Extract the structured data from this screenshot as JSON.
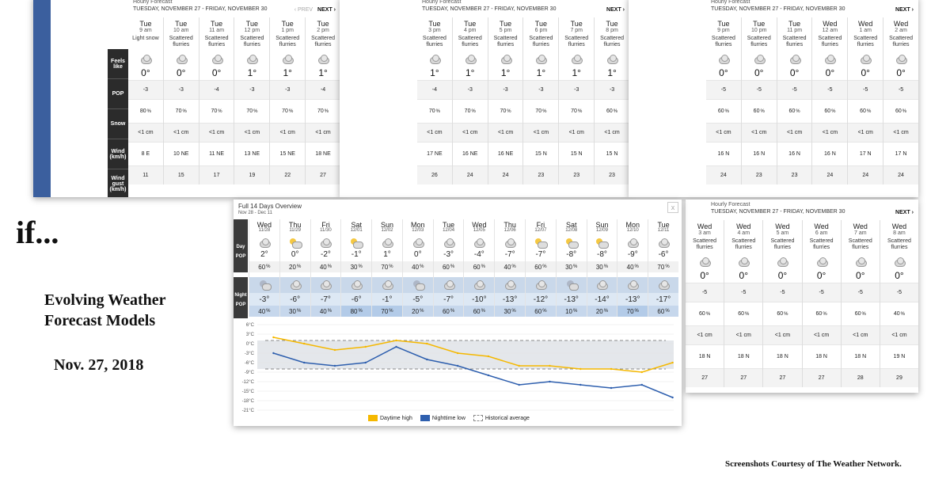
{
  "colors": {
    "daytime": "#f5b800",
    "nighttime": "#2e5fae",
    "historical": "#888888"
  },
  "slide": {
    "if_text": "if...",
    "heading_line1": "Evolving Weather",
    "heading_line2": "Forecast Models",
    "date": "Nov. 27, 2018",
    "credit": "Screenshots Courtesy of The Weather Network."
  },
  "hourly_header": {
    "title": "Hourly Forecast",
    "range": "TUESDAY, NOVEMBER 27 - FRIDAY, NOVEMBER 30",
    "prev": "‹ PREV",
    "next": "NEXT ›"
  },
  "row_labels": {
    "feels": "Feels like",
    "pop": "POP",
    "snow": "Snow",
    "wind": "Wind (km/h)",
    "gust": "Wind gust (km/h)"
  },
  "panel1": [
    {
      "day": "Tue",
      "time": "9 am",
      "cond": "Light snow",
      "temp": "0°",
      "feels": "-3",
      "pop": "80",
      "snow": "<1 cm",
      "wind": "8 E",
      "gust": "11",
      "icon": "cloud-snow-icon"
    },
    {
      "day": "Tue",
      "time": "10 am",
      "cond": "Scattered flurries",
      "temp": "0°",
      "feels": "-3",
      "pop": "70",
      "snow": "<1 cm",
      "wind": "10 NE",
      "gust": "15",
      "icon": "cloud-snow-icon"
    },
    {
      "day": "Tue",
      "time": "11 am",
      "cond": "Scattered flurries",
      "temp": "0°",
      "feels": "-4",
      "pop": "70",
      "snow": "<1 cm",
      "wind": "11 NE",
      "gust": "17",
      "icon": "cloud-snow-icon"
    },
    {
      "day": "Tue",
      "time": "12 pm",
      "cond": "Scattered flurries",
      "temp": "1°",
      "feels": "-3",
      "pop": "70",
      "snow": "<1 cm",
      "wind": "13 NE",
      "gust": "19",
      "icon": "cloud-snow-icon"
    },
    {
      "day": "Tue",
      "time": "1 pm",
      "cond": "Scattered flurries",
      "temp": "1°",
      "feels": "-3",
      "pop": "70",
      "snow": "<1 cm",
      "wind": "15 NE",
      "gust": "22",
      "icon": "cloud-snow-icon"
    },
    {
      "day": "Tue",
      "time": "2 pm",
      "cond": "Scattered flurries",
      "temp": "1°",
      "feels": "-4",
      "pop": "70",
      "snow": "<1 cm",
      "wind": "18 NE",
      "gust": "27",
      "icon": "cloud-snow-icon"
    }
  ],
  "panel2": [
    {
      "day": "Tue",
      "time": "3 pm",
      "cond": "Scattered flurries",
      "temp": "1°",
      "feels": "-4",
      "pop": "70",
      "snow": "<1 cm",
      "wind": "17 NE",
      "gust": "26"
    },
    {
      "day": "Tue",
      "time": "4 pm",
      "cond": "Scattered flurries",
      "temp": "1°",
      "feels": "-3",
      "pop": "70",
      "snow": "<1 cm",
      "wind": "16 NE",
      "gust": "24"
    },
    {
      "day": "Tue",
      "time": "5 pm",
      "cond": "Scattered flurries",
      "temp": "1°",
      "feels": "-3",
      "pop": "70",
      "snow": "<1 cm",
      "wind": "16 NE",
      "gust": "24"
    },
    {
      "day": "Tue",
      "time": "6 pm",
      "cond": "Scattered flurries",
      "temp": "1°",
      "feels": "-3",
      "pop": "70",
      "snow": "<1 cm",
      "wind": "15 N",
      "gust": "23"
    },
    {
      "day": "Tue",
      "time": "7 pm",
      "cond": "Scattered flurries",
      "temp": "1°",
      "feels": "-3",
      "pop": "70",
      "snow": "<1 cm",
      "wind": "15 N",
      "gust": "23"
    },
    {
      "day": "Tue",
      "time": "8 pm",
      "cond": "Scattered flurries",
      "temp": "1°",
      "feels": "-3",
      "pop": "60",
      "snow": "<1 cm",
      "wind": "15 N",
      "gust": "23"
    }
  ],
  "panel3": [
    {
      "day": "Tue",
      "time": "9 pm",
      "cond": "Scattered flurries",
      "temp": "0°",
      "feels": "-5",
      "pop": "60",
      "snow": "<1 cm",
      "wind": "16 N",
      "gust": "24"
    },
    {
      "day": "Tue",
      "time": "10 pm",
      "cond": "Scattered flurries",
      "temp": "0°",
      "feels": "-5",
      "pop": "60",
      "snow": "<1 cm",
      "wind": "16 N",
      "gust": "23"
    },
    {
      "day": "Tue",
      "time": "11 pm",
      "cond": "Scattered flurries",
      "temp": "0°",
      "feels": "-5",
      "pop": "60",
      "snow": "<1 cm",
      "wind": "16 N",
      "gust": "23"
    },
    {
      "day": "Wed",
      "time": "12 am",
      "cond": "Scattered flurries",
      "temp": "0°",
      "feels": "-5",
      "pop": "60",
      "snow": "<1 cm",
      "wind": "16 N",
      "gust": "24"
    },
    {
      "day": "Wed",
      "time": "1 am",
      "cond": "Scattered flurries",
      "temp": "0°",
      "feels": "-5",
      "pop": "60",
      "snow": "<1 cm",
      "wind": "17 N",
      "gust": "24"
    },
    {
      "day": "Wed",
      "time": "2 am",
      "cond": "Scattered flurries",
      "temp": "0°",
      "feels": "-5",
      "pop": "60",
      "snow": "<1 cm",
      "wind": "17 N",
      "gust": "24"
    }
  ],
  "panel4": [
    {
      "day": "Wed",
      "time": "3 am",
      "cond": "Scattered flurries",
      "temp": "0°",
      "feels": "-5",
      "pop": "60",
      "snow": "<1 cm",
      "wind": "18 N",
      "gust": "27"
    },
    {
      "day": "Wed",
      "time": "4 am",
      "cond": "Scattered flurries",
      "temp": "0°",
      "feels": "-5",
      "pop": "60",
      "snow": "<1 cm",
      "wind": "18 N",
      "gust": "27"
    },
    {
      "day": "Wed",
      "time": "5 am",
      "cond": "Scattered flurries",
      "temp": "0°",
      "feels": "-5",
      "pop": "60",
      "snow": "<1 cm",
      "wind": "18 N",
      "gust": "27"
    },
    {
      "day": "Wed",
      "time": "6 am",
      "cond": "Scattered flurries",
      "temp": "0°",
      "feels": "-5",
      "pop": "60",
      "snow": "<1 cm",
      "wind": "18 N",
      "gust": "27"
    },
    {
      "day": "Wed",
      "time": "7 am",
      "cond": "Scattered flurries",
      "temp": "0°",
      "feels": "-5",
      "pop": "60",
      "snow": "<1 cm",
      "wind": "18 N",
      "gust": "28"
    },
    {
      "day": "Wed",
      "time": "8 am",
      "cond": "Scattered flurries",
      "temp": "0°",
      "feels": "-5",
      "pop": "40",
      "snow": "<1 cm",
      "wind": "19 N",
      "gust": "29"
    }
  ],
  "overview": {
    "title": "Full 14 Days Overview",
    "range": "Nov 28 - Dec 11",
    "close": "x",
    "labels": {
      "day": "Day",
      "pop": "POP",
      "night": "Night"
    },
    "pct": "%",
    "days": [
      {
        "d": "Wed",
        "date": "11/28",
        "hi": "2°",
        "dpop": "60",
        "lo": "-3°",
        "npop": "40",
        "di": "cloud",
        "ni": "moon"
      },
      {
        "d": "Thu",
        "date": "11/29",
        "hi": "0°",
        "dpop": "20",
        "lo": "-6°",
        "npop": "30",
        "di": "sun",
        "ni": "cloud"
      },
      {
        "d": "Fri",
        "date": "11/30",
        "hi": "-2°",
        "dpop": "40",
        "lo": "-7°",
        "npop": "40",
        "di": "cloud",
        "ni": "cloud"
      },
      {
        "d": "Sat",
        "date": "12/01",
        "hi": "-1°",
        "dpop": "30",
        "lo": "-6°",
        "npop": "80",
        "di": "sun",
        "ni": "cloud"
      },
      {
        "d": "Sun",
        "date": "12/02",
        "hi": "1°",
        "dpop": "70",
        "lo": "-1°",
        "npop": "70",
        "di": "cloud",
        "ni": "cloud"
      },
      {
        "d": "Mon",
        "date": "12/03",
        "hi": "0°",
        "dpop": "40",
        "lo": "-5°",
        "npop": "20",
        "di": "cloud",
        "ni": "moon"
      },
      {
        "d": "Tue",
        "date": "12/04",
        "hi": "-3°",
        "dpop": "60",
        "lo": "-7°",
        "npop": "60",
        "di": "cloud",
        "ni": "cloud"
      },
      {
        "d": "Wed",
        "date": "12/05",
        "hi": "-4°",
        "dpop": "60",
        "lo": "-10°",
        "npop": "60",
        "di": "cloud",
        "ni": "cloud"
      },
      {
        "d": "Thu",
        "date": "12/06",
        "hi": "-7°",
        "dpop": "40",
        "lo": "-13°",
        "npop": "30",
        "di": "cloud",
        "ni": "cloud"
      },
      {
        "d": "Fri",
        "date": "12/07",
        "hi": "-7°",
        "dpop": "60",
        "lo": "-12°",
        "npop": "60",
        "di": "sun",
        "ni": "cloud"
      },
      {
        "d": "Sat",
        "date": "12/08",
        "hi": "-8°",
        "dpop": "30",
        "lo": "-13°",
        "npop": "10",
        "di": "sun",
        "ni": "moon"
      },
      {
        "d": "Sun",
        "date": "12/09",
        "hi": "-8°",
        "dpop": "30",
        "lo": "-14°",
        "npop": "20",
        "di": "sun",
        "ni": "cloud"
      },
      {
        "d": "Mon",
        "date": "12/10",
        "hi": "-9°",
        "dpop": "40",
        "lo": "-13°",
        "npop": "70",
        "di": "cloud",
        "ni": "cloud"
      },
      {
        "d": "Tue",
        "date": "12/11",
        "hi": "-6°",
        "dpop": "70",
        "lo": "-17°",
        "npop": "60",
        "di": "cloud",
        "ni": "cloud"
      }
    ],
    "legend": {
      "day": "Daytime high",
      "night": "Nighttime low",
      "hist": "Historical average"
    }
  },
  "chart_data": {
    "type": "line",
    "x": [
      "11/28",
      "11/29",
      "11/30",
      "12/01",
      "12/02",
      "12/03",
      "12/04",
      "12/05",
      "12/06",
      "12/07",
      "12/08",
      "12/09",
      "12/10",
      "12/11"
    ],
    "series": [
      {
        "name": "Daytime high",
        "values": [
          2,
          0,
          -2,
          -1,
          1,
          0,
          -3,
          -4,
          -7,
          -7,
          -8,
          -8,
          -9,
          -6
        ]
      },
      {
        "name": "Nighttime low",
        "values": [
          -3,
          -6,
          -7,
          -6,
          -1,
          -5,
          -7,
          -10,
          -13,
          -12,
          -13,
          -14,
          -13,
          -17
        ]
      }
    ],
    "historical": [
      1,
      -8
    ],
    "ylim": [
      -21,
      6
    ],
    "yticks": [
      "6°C",
      "3°C",
      "0°C",
      "-3°C",
      "-6°C",
      "-9°C",
      "-12°C",
      "-15°C",
      "-18°C",
      "-21°C"
    ],
    "yvals": [
      6,
      3,
      0,
      -3,
      -6,
      -9,
      -12,
      -15,
      -18,
      -21
    ],
    "legend": "bottom"
  }
}
